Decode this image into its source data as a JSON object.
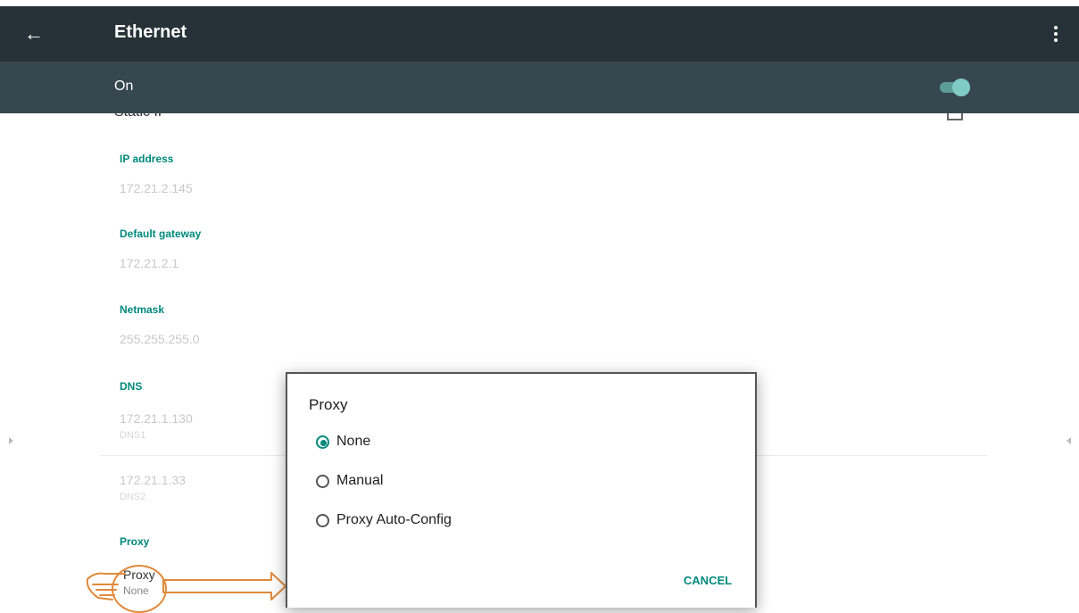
{
  "toolbar": {
    "title": "Ethernet"
  },
  "switch_bar": {
    "label": "On",
    "enabled": true
  },
  "settings": {
    "partial_row": "Static IP",
    "ip_address": {
      "label": "IP address",
      "value": "172.21.2.145"
    },
    "default_gateway": {
      "label": "Default gateway",
      "value": "172.21.2.1"
    },
    "netmask": {
      "label": "Netmask",
      "value": "255.255.255.0"
    },
    "dns": {
      "label": "DNS",
      "dns1_value": "172.21.1.130",
      "dns1_label": "DNS1",
      "dns2_value": "172.21.1.33",
      "dns2_label": "DNS2"
    },
    "proxy": {
      "section_label": "Proxy",
      "item_title": "Proxy",
      "item_value": "None"
    }
  },
  "dialog": {
    "title": "Proxy",
    "options": [
      {
        "label": "None",
        "checked": true
      },
      {
        "label": "Manual",
        "checked": false
      },
      {
        "label": "Proxy Auto-Config",
        "checked": false
      }
    ],
    "cancel_label": "CANCEL"
  },
  "colors": {
    "toolbar": "#263238",
    "switch_bar": "#37474f",
    "accent": "#00897b",
    "annotation": "#e08a3c"
  }
}
